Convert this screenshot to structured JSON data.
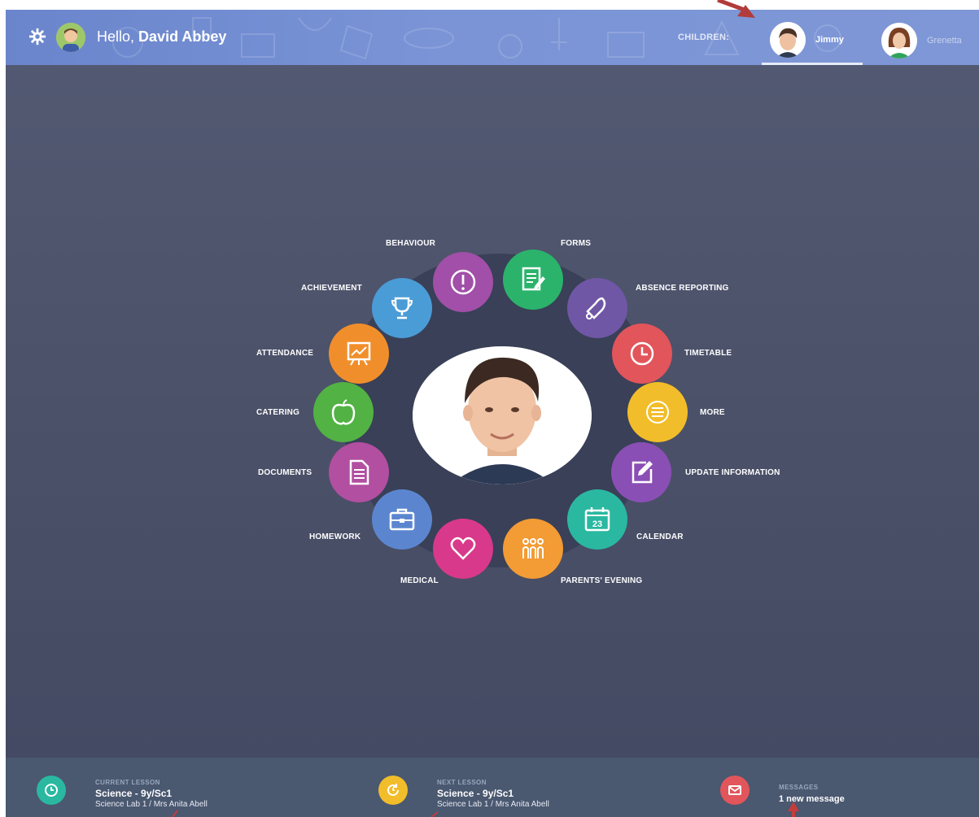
{
  "header": {
    "greeting": "Hello,",
    "user_name": "David Abbey",
    "children_label": "CHILDREN:",
    "children": [
      {
        "name": "Jimmy",
        "active": true
      },
      {
        "name": "Grenetta",
        "active": false
      }
    ]
  },
  "menu": {
    "items": [
      {
        "label": "BEHAVIOUR",
        "color": "#a14fa8",
        "icon": "exclamation-icon"
      },
      {
        "label": "FORMS",
        "color": "#2bb36b",
        "icon": "form-edit-icon"
      },
      {
        "label": "ABSENCE REPORTING",
        "color": "#6f57a6",
        "icon": "bell-icon"
      },
      {
        "label": "TIMETABLE",
        "color": "#e2555b",
        "icon": "clock-icon"
      },
      {
        "label": "MORE",
        "color": "#f2bd2a",
        "icon": "list-icon"
      },
      {
        "label": "UPDATE INFORMATION",
        "color": "#8a4fb5",
        "icon": "pencil-edit-icon"
      },
      {
        "label": "CALENDAR",
        "color": "#2ab8a1",
        "icon": "calendar-icon",
        "icon_text": "23"
      },
      {
        "label": "PARENTS' EVENING",
        "color": "#f39b34",
        "icon": "people-icon"
      },
      {
        "label": "MEDICAL",
        "color": "#d9398b",
        "icon": "heart-icon"
      },
      {
        "label": "HOMEWORK",
        "color": "#5b86cf",
        "icon": "briefcase-icon"
      },
      {
        "label": "DOCUMENTS",
        "color": "#b24fa1",
        "icon": "document-icon"
      },
      {
        "label": "CATERING",
        "color": "#52b244",
        "icon": "apple-icon"
      },
      {
        "label": "ATTENDANCE",
        "color": "#f18e2c",
        "icon": "presentation-chart-icon"
      },
      {
        "label": "ACHIEVEMENT",
        "color": "#4a9cd6",
        "icon": "trophy-icon"
      }
    ]
  },
  "footer": {
    "current": {
      "caption": "CURRENT LESSON",
      "title": "Science - 9y/Sc1",
      "sub": "Science Lab 1 / Mrs Anita Abell",
      "color": "#2ab8a1"
    },
    "next": {
      "caption": "NEXT LESSON",
      "title": "Science - 9y/Sc1",
      "sub": "Science Lab 1 / Mrs Anita Abell",
      "color": "#f2bd2a"
    },
    "messages": {
      "caption": "MESSAGES",
      "title": "1 new message",
      "color": "#e2555b"
    }
  }
}
